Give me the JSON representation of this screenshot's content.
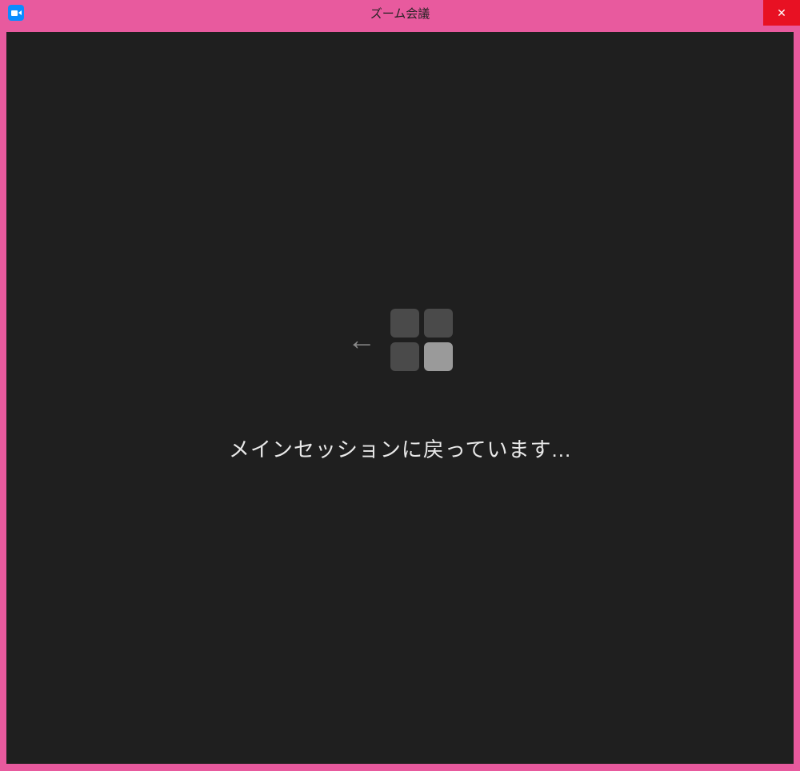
{
  "window": {
    "title": "ズーム会議",
    "close_symbol": "✕"
  },
  "content": {
    "arrow_symbol": "←",
    "status_message": "メインセッションに戻っています..."
  },
  "colors": {
    "accent": "#e85a9e",
    "content_bg": "#1f1f1f",
    "close_bg": "#e81123",
    "zoom_blue": "#0b8cff"
  }
}
